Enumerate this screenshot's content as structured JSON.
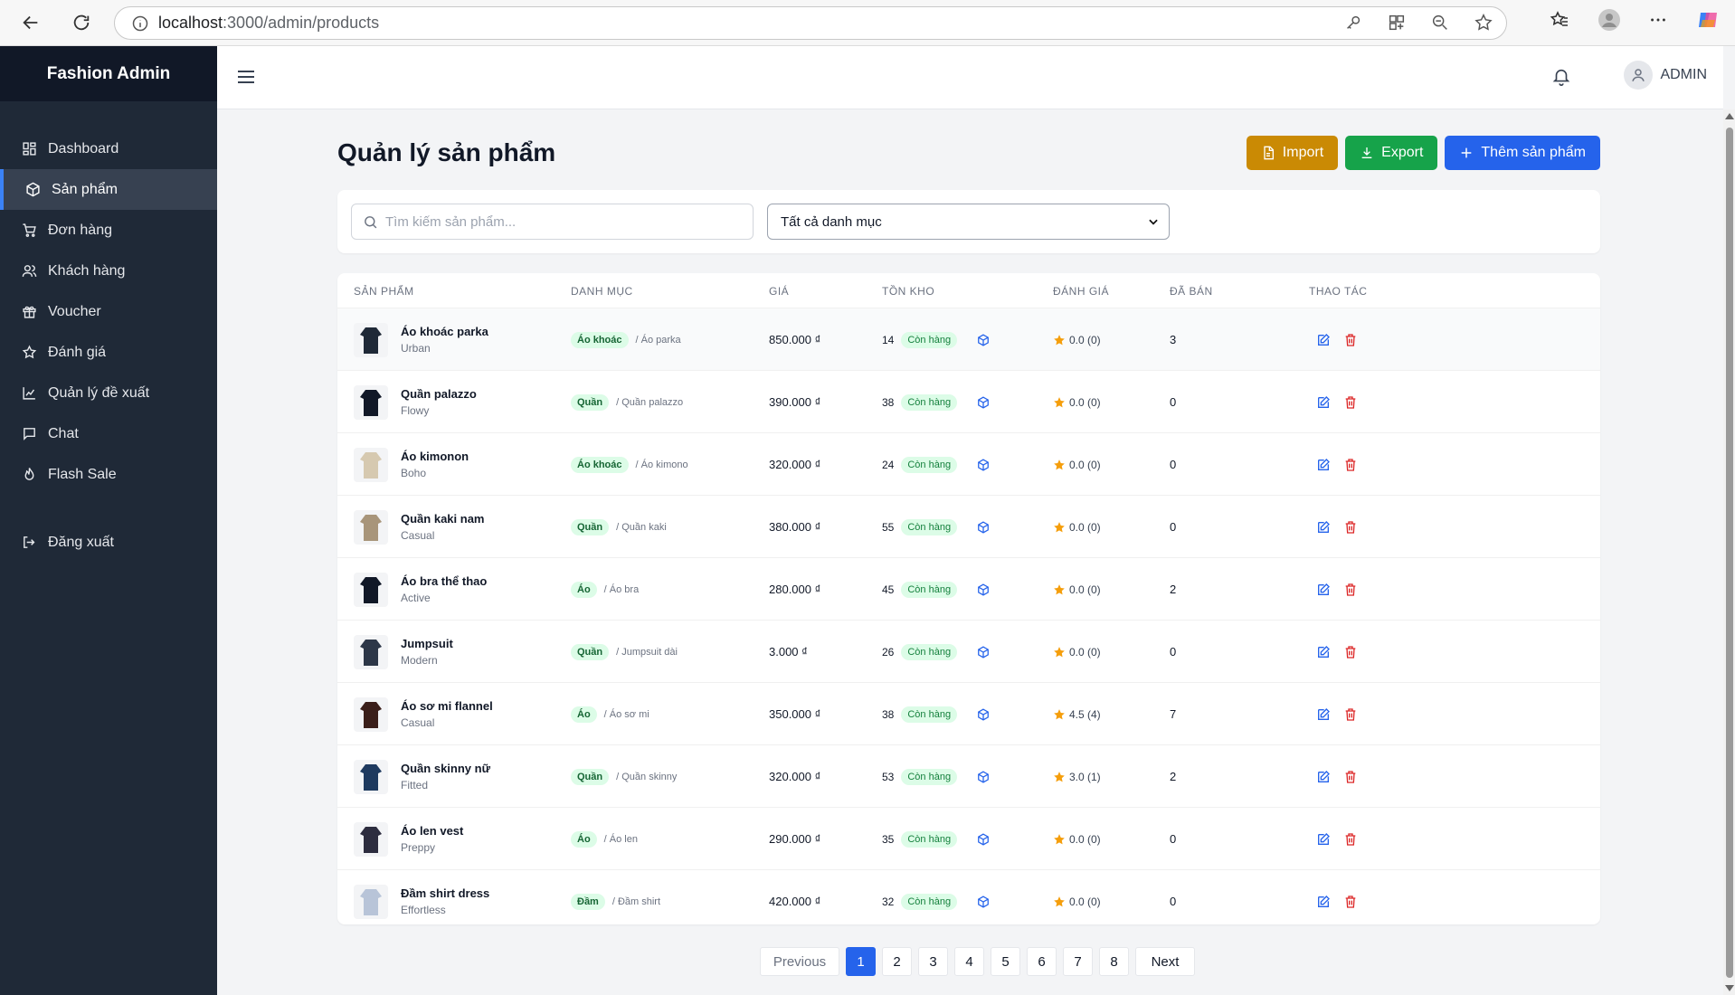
{
  "browser": {
    "url_host": "localhost",
    "url_path": ":3000/admin/products"
  },
  "sidebar": {
    "brand": "Fashion Admin",
    "items": [
      {
        "label": "Dashboard",
        "icon": "dashboard-icon"
      },
      {
        "label": "Sản phẩm",
        "icon": "box-icon",
        "active": true
      },
      {
        "label": "Đơn hàng",
        "icon": "cart-icon"
      },
      {
        "label": "Khách hàng",
        "icon": "users-icon"
      },
      {
        "label": "Voucher",
        "icon": "gift-icon"
      },
      {
        "label": "Đánh giá",
        "icon": "star-icon"
      },
      {
        "label": "Quản lý đề xuất",
        "icon": "chart-icon"
      },
      {
        "label": "Chat",
        "icon": "chat-icon"
      },
      {
        "label": "Flash Sale",
        "icon": "flame-icon"
      }
    ],
    "logout": "Đăng xuất"
  },
  "header": {
    "user": "ADMIN"
  },
  "main": {
    "title": "Quản lý sản phẩm",
    "buttons": {
      "import": "Import",
      "export": "Export",
      "add": "Thêm sản phẩm"
    },
    "search_placeholder": "Tìm kiếm sản phẩm...",
    "category_select": "Tất cả danh mục",
    "columns": [
      "SẢN PHẨM",
      "DANH MỤC",
      "GIÁ",
      "TỒN KHO",
      "ĐÁNH GIÁ",
      "ĐÃ BÁN",
      "THAO TÁC"
    ],
    "rows": [
      {
        "name": "Áo khoác parka",
        "brand": "Urban",
        "cat": "Áo khoác",
        "subcat": "/ Áo parka",
        "price": "850.000 ₫",
        "stock": "14",
        "status": "Còn hàng",
        "rating": "0.0 (0)",
        "sold": "3"
      },
      {
        "name": "Quần palazzo",
        "brand": "Flowy",
        "cat": "Quần",
        "subcat": "/ Quần palazzo",
        "price": "390.000 ₫",
        "stock": "38",
        "status": "Còn hàng",
        "rating": "0.0 (0)",
        "sold": "0"
      },
      {
        "name": "Áo kimonon",
        "brand": "Boho",
        "cat": "Áo khoác",
        "subcat": "/ Áo kimono",
        "price": "320.000 ₫",
        "stock": "24",
        "status": "Còn hàng",
        "rating": "0.0 (0)",
        "sold": "0"
      },
      {
        "name": "Quần kaki nam",
        "brand": "Casual",
        "cat": "Quần",
        "subcat": "/ Quần kaki",
        "price": "380.000 ₫",
        "stock": "55",
        "status": "Còn hàng",
        "rating": "0.0 (0)",
        "sold": "0"
      },
      {
        "name": "Áo bra thể thao",
        "brand": "Active",
        "cat": "Áo",
        "subcat": "/ Áo bra",
        "price": "280.000 ₫",
        "stock": "45",
        "status": "Còn hàng",
        "rating": "0.0 (0)",
        "sold": "2"
      },
      {
        "name": "Jumpsuit",
        "brand": "Modern",
        "cat": "Quần",
        "subcat": "/ Jumpsuit dài",
        "price": "3.000 ₫",
        "stock": "26",
        "status": "Còn hàng",
        "rating": "0.0 (0)",
        "sold": "0"
      },
      {
        "name": "Áo sơ mi flannel",
        "brand": "Casual",
        "cat": "Áo",
        "subcat": "/ Áo sơ mi",
        "price": "350.000 ₫",
        "stock": "38",
        "status": "Còn hàng",
        "rating": "4.5 (4)",
        "sold": "7"
      },
      {
        "name": "Quần skinny nữ",
        "brand": "Fitted",
        "cat": "Quần",
        "subcat": "/ Quần skinny",
        "price": "320.000 ₫",
        "stock": "53",
        "status": "Còn hàng",
        "rating": "3.0 (1)",
        "sold": "2"
      },
      {
        "name": "Áo len vest",
        "brand": "Preppy",
        "cat": "Áo",
        "subcat": "/ Áo len",
        "price": "290.000 ₫",
        "stock": "35",
        "status": "Còn hàng",
        "rating": "0.0 (0)",
        "sold": "0"
      },
      {
        "name": "Đầm shirt dress",
        "brand": "Effortless",
        "cat": "Đầm",
        "subcat": "/ Đầm shirt",
        "price": "420.000 ₫",
        "stock": "32",
        "status": "Còn hàng",
        "rating": "0.0 (0)",
        "sold": "0"
      }
    ],
    "pagination": {
      "prev": "Previous",
      "pages": [
        "1",
        "2",
        "3",
        "4",
        "5",
        "6",
        "7",
        "8"
      ],
      "active": "1",
      "next": "Next"
    }
  },
  "colors": {
    "sidebar": "#1f2937",
    "brand_bg": "#111827",
    "import": "#ca8a04",
    "export": "#16a34a",
    "add": "#2563eb",
    "star": "#f59e0b",
    "edit": "#2563eb",
    "delete": "#dc2626"
  }
}
